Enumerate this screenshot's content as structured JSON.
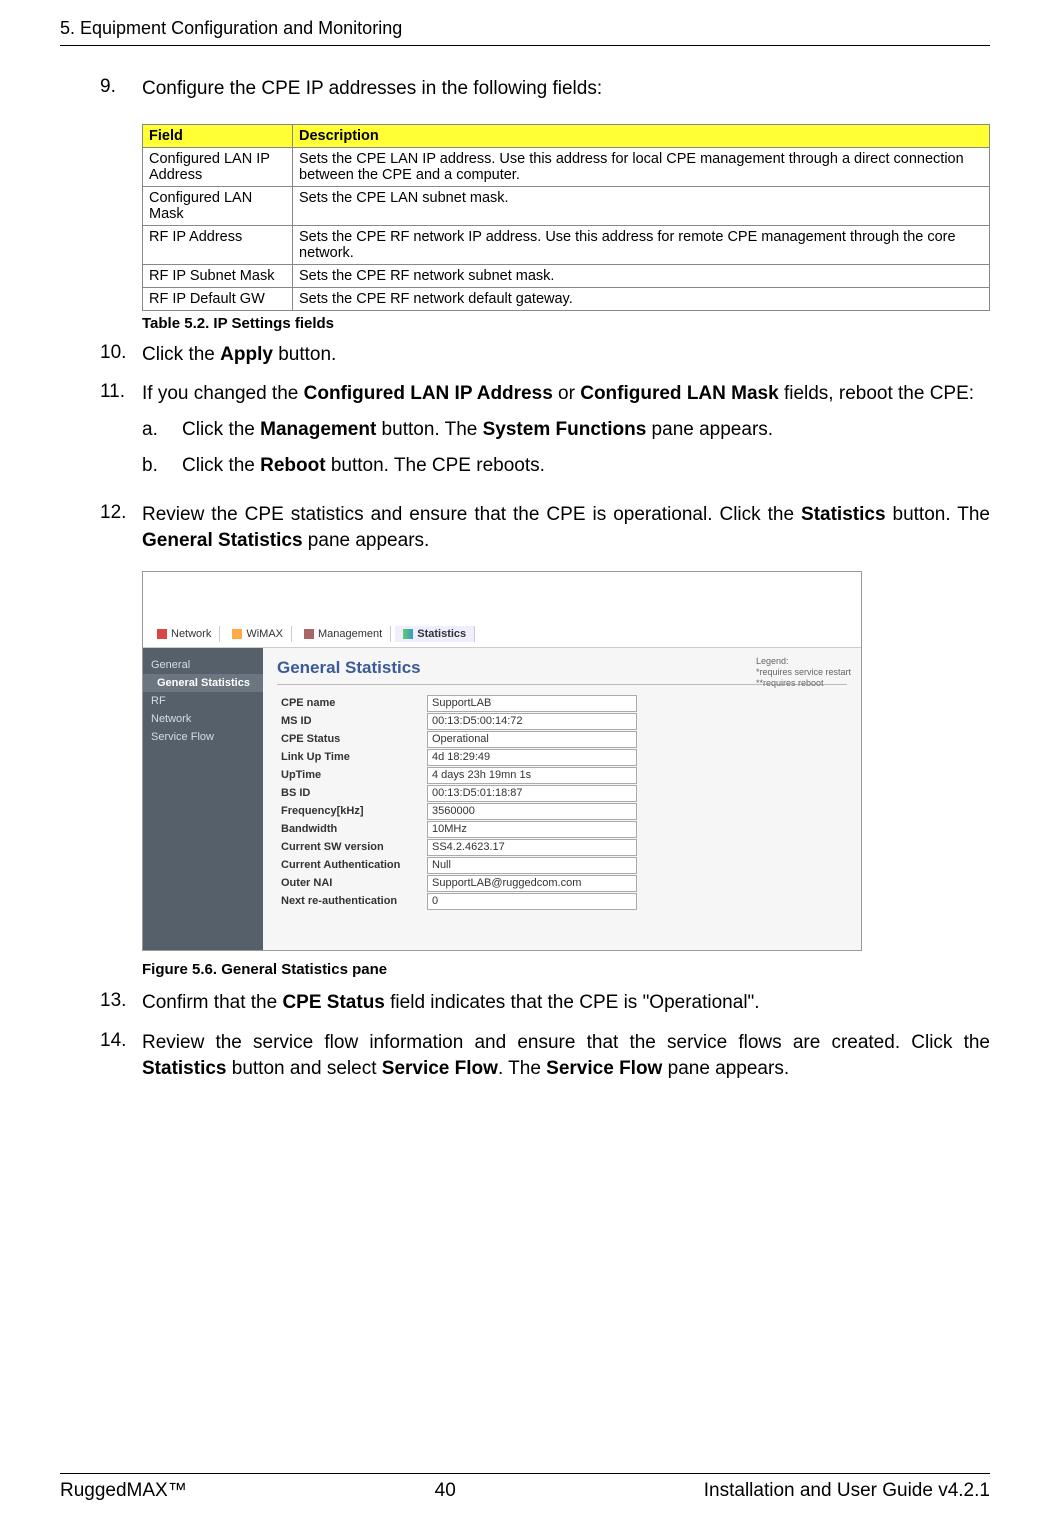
{
  "header": {
    "chapter": "5. Equipment Configuration and Monitoring"
  },
  "step9": {
    "num": "9.",
    "text": "Configure the CPE IP addresses in the following fields:"
  },
  "table": {
    "headers": {
      "field": "Field",
      "description": "Description"
    },
    "rows": [
      {
        "field": "Configured LAN IP Address",
        "description": "Sets the CPE LAN IP address. Use this address for local CPE management through a direct connection between the CPE and a computer."
      },
      {
        "field": "Configured LAN Mask",
        "description": "Sets the CPE LAN subnet mask."
      },
      {
        "field": "RF IP Address",
        "description": "Sets the CPE RF network IP address. Use this address for remote CPE management through the core network."
      },
      {
        "field": "RF IP Subnet Mask",
        "description": "Sets the CPE RF network subnet mask."
      },
      {
        "field": "RF IP Default GW",
        "description": "Sets the CPE RF network default gateway."
      }
    ],
    "caption": "Table 5.2. IP Settings fields"
  },
  "step10": {
    "num": "10.",
    "pre": "Click the ",
    "bold1": "Apply",
    "post": " button."
  },
  "step11": {
    "num": "11.",
    "pre": "If you changed the ",
    "bold1": "Configured LAN IP Address",
    "mid1": " or ",
    "bold2": "Configured LAN Mask",
    "post": " fields, reboot the CPE:"
  },
  "step11a": {
    "num": "a.",
    "pre": "Click the ",
    "bold1": "Management",
    "mid1": " button. The ",
    "bold2": "System Functions",
    "post": " pane appears."
  },
  "step11b": {
    "num": "b.",
    "pre": "Click the ",
    "bold1": "Reboot",
    "post": " button. The CPE reboots."
  },
  "step12": {
    "num": "12.",
    "pre": "Review the CPE statistics and ensure that the CPE is operational. Click the ",
    "bold1": "Statistics",
    "mid1": " button. The ",
    "bold2": "General Statistics",
    "post": " pane appears."
  },
  "screenshot": {
    "tabs": {
      "network": "Network",
      "wimax": "WiMAX",
      "management": "Management",
      "statistics": "Statistics"
    },
    "sidebar": {
      "general": "General",
      "general_stats": "General Statistics",
      "rf": "RF",
      "network": "Network",
      "service_flow": "Service Flow"
    },
    "title": "General Statistics",
    "legend": {
      "header": "Legend:",
      "line1": "*requires service restart",
      "line2": "**requires reboot"
    },
    "stats": [
      {
        "label": "CPE name",
        "value": "SupportLAB"
      },
      {
        "label": "MS ID",
        "value": "00:13:D5:00:14:72"
      },
      {
        "label": "CPE Status",
        "value": "Operational"
      },
      {
        "label": "Link Up Time",
        "value": "4d 18:29:49"
      },
      {
        "label": "UpTime",
        "value": "4 days 23h 19mn 1s"
      },
      {
        "label": "BS ID",
        "value": "00:13:D5:01:18:87"
      },
      {
        "label": "Frequency[kHz]",
        "value": "3560000"
      },
      {
        "label": "Bandwidth",
        "value": "10MHz"
      },
      {
        "label": "Current SW version",
        "value": "SS4.2.4623.17"
      },
      {
        "label": "Current Authentication",
        "value": "Null"
      },
      {
        "label": "Outer NAI",
        "value": "SupportLAB@ruggedcom.com"
      },
      {
        "label": "Next re-authentication",
        "value": "0"
      }
    ],
    "caption": "Figure 5.6. General Statistics pane"
  },
  "step13": {
    "num": "13.",
    "pre": "Confirm that the ",
    "bold1": "CPE Status",
    "post": " field indicates that the CPE is \"Operational\"."
  },
  "step14": {
    "num": "14.",
    "pre": "Review the service flow information and ensure that the service flows are created. Click the ",
    "bold1": "Statistics",
    "mid1": " button and select ",
    "bold2": "Service Flow",
    "mid2": ". The ",
    "bold3": "Service Flow",
    "post": " pane appears."
  },
  "footer": {
    "left": "RuggedMAX™",
    "center": "40",
    "right": "Installation and User Guide v4.2.1"
  }
}
